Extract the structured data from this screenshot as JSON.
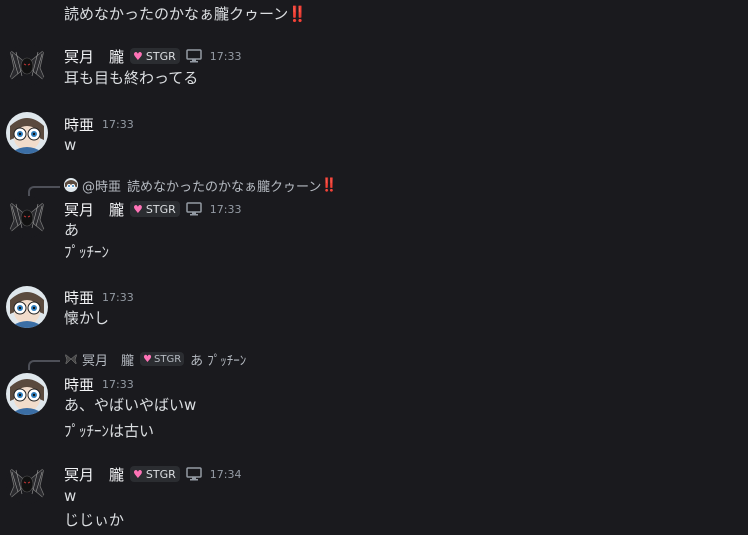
{
  "messages": {
    "m0": {
      "text": "読めなかったのかなぁ朧クゥーン",
      "emoji": "‼️"
    },
    "m1": {
      "username": "冥月　朧",
      "badge": "STGR",
      "timestamp": "17:33",
      "lines": [
        "耳も目も終わってる"
      ]
    },
    "m2": {
      "username": "時亜",
      "timestamp": "17:33",
      "lines": [
        "w"
      ]
    },
    "m3": {
      "reply": {
        "name": "@時亜",
        "text": "読めなかったのかなぁ朧クゥーン",
        "emoji": "‼️"
      },
      "username": "冥月　朧",
      "badge": "STGR",
      "timestamp": "17:33",
      "lines": [
        "あ",
        "ﾌﾟｯﾁｰﾝ"
      ]
    },
    "m4": {
      "username": "時亜",
      "timestamp": "17:33",
      "lines": [
        "懐かし"
      ]
    },
    "m5": {
      "reply": {
        "name": "冥月　朧",
        "badge": "STGR",
        "text": "あ ﾌﾟｯﾁｰﾝ"
      },
      "username": "時亜",
      "timestamp": "17:33",
      "lines": [
        "あ、やばいやばいw",
        "ﾌﾟｯﾁｰﾝは古い"
      ]
    },
    "m6": {
      "username": "冥月　朧",
      "badge": "STGR",
      "timestamp": "17:34",
      "lines": [
        "w",
        "じじぃか"
      ]
    }
  },
  "icons": {
    "badge_icon": "heart-icon",
    "device_icon": "desktop-icon"
  },
  "colors": {
    "background": "#1a1a1e",
    "badge_heart": "#ff73b7",
    "bang": "#d9304a",
    "timestamp": "#949ba4"
  }
}
